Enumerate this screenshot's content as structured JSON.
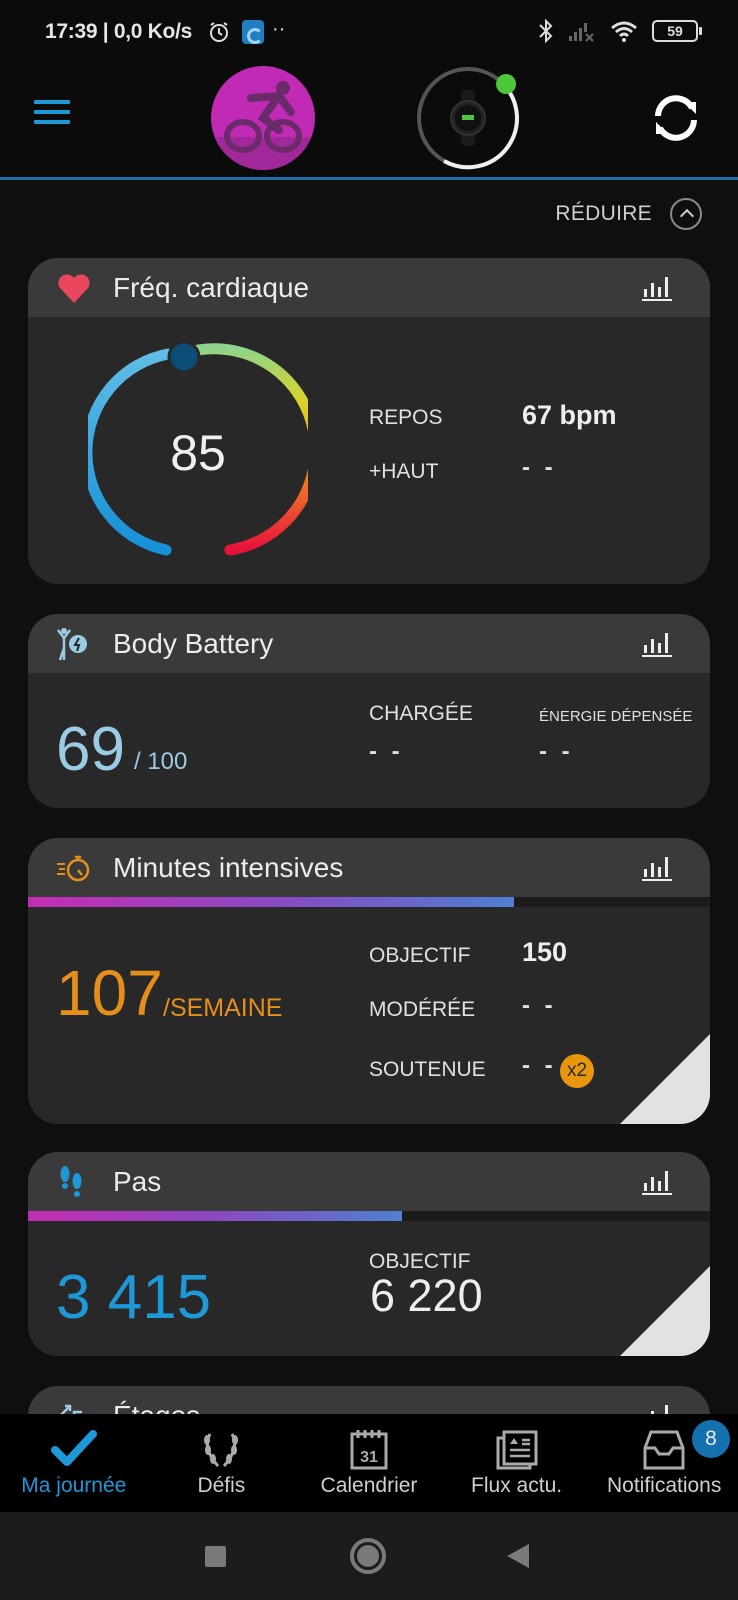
{
  "status_bar": {
    "time_and_speed": "17:39 | 0,0 Ko/s",
    "icons": [
      "alarm-icon",
      "app-notification-icon",
      "more-dots-icon",
      "bluetooth-icon",
      "cell-signal-off-icon",
      "wifi-icon",
      "battery-icon"
    ],
    "more_dots": "··",
    "battery_level": "59"
  },
  "header": {
    "menu_icon": "hamburger-menu-icon",
    "activity_icon": "cycling-icon",
    "device_icon": "watch-icon",
    "sync_icon": "sync-icon",
    "device_status_color": "#4cc83a"
  },
  "collapse": {
    "label": "RÉDUIRE"
  },
  "cards": {
    "heart_rate": {
      "title": "Fréq. cardiaque",
      "current": "85",
      "rest_label": "REPOS",
      "rest_value": "67 bpm",
      "high_label": "+HAUT",
      "high_value": "- -"
    },
    "body_battery": {
      "title": "Body Battery",
      "value": "69",
      "max": "/ 100",
      "charged_label": "CHARGÉE",
      "charged_value": "- -",
      "drained_label": "ÉNERGIE DÉPENSÉE",
      "drained_value": "- -"
    },
    "intensity_minutes": {
      "title": "Minutes intensives",
      "value": "107",
      "unit": "/SEMAINE",
      "progress": 0.713,
      "goal_label": "OBJECTIF",
      "goal_value": "150",
      "moderate_label": "MODÉRÉE",
      "moderate_value": "- -",
      "vigorous_label": "SOUTENUE",
      "vigorous_value": "- -",
      "vigorous_multiplier": "x2"
    },
    "steps": {
      "title": "Pas",
      "value": "3 415",
      "progress": 0.549,
      "goal_label": "OBJECTIF",
      "goal_value": "6 220"
    },
    "floors": {
      "title": "Étages"
    }
  },
  "bottom_nav": {
    "items": [
      {
        "label": "Ma journée",
        "icon": "checkmark-icon",
        "active": true
      },
      {
        "label": "Défis",
        "icon": "laurel-icon",
        "active": false
      },
      {
        "label": "Calendrier",
        "icon": "calendar-icon",
        "active": false,
        "calendar_day": "31"
      },
      {
        "label": "Flux actu.",
        "icon": "newsfeed-icon",
        "active": false
      },
      {
        "label": "Notifications",
        "icon": "inbox-icon",
        "active": false
      }
    ],
    "notifications_badge": "8"
  },
  "colors": {
    "accent": "#1e98d6",
    "intensity": "#e58f1b",
    "body_battery": "#9ccbe6",
    "activity": "#c02ab5"
  }
}
